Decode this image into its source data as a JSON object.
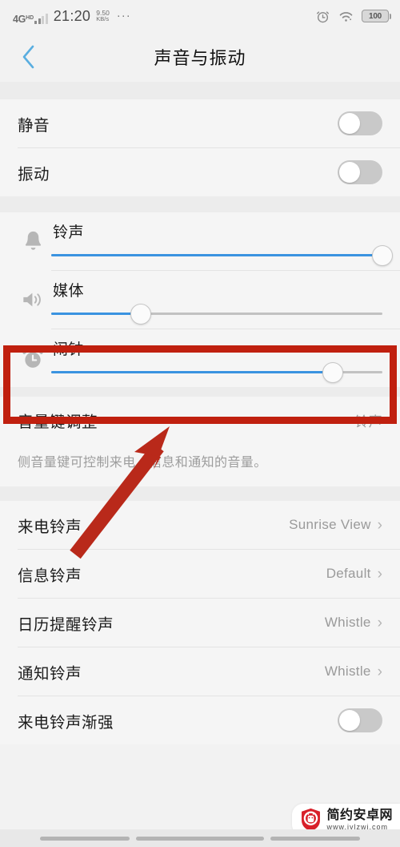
{
  "status_bar": {
    "network": "4G",
    "network_sup": "HD",
    "time": "21:20",
    "speed_value": "9.50",
    "speed_unit": "KB/s",
    "overflow": "···",
    "alarm_icon": "alarm-clock-icon",
    "wifi_icon": "wifi-icon",
    "battery_level": "100"
  },
  "header": {
    "back_icon": "back-chevron-icon",
    "title": "声音与振动"
  },
  "toggles": [
    {
      "label": "静音",
      "state": "off"
    },
    {
      "label": "振动",
      "state": "off"
    }
  ],
  "sliders": [
    {
      "label": "铃声",
      "icon": "bell-icon",
      "percent": 100
    },
    {
      "label": "媒体",
      "icon": "speaker-icon",
      "percent": 27
    },
    {
      "label": "闹钟",
      "icon": "alarm-clock-icon",
      "percent": 85
    }
  ],
  "volume_key": {
    "label": "音量键调整",
    "value": "铃声",
    "description": "侧音量键可控制来电、信息和通知的音量。"
  },
  "ringtone_rows": [
    {
      "label": "来电铃声",
      "value": "Sunrise View",
      "chevron": "›"
    },
    {
      "label": "信息铃声",
      "value": "Default",
      "chevron": "›"
    },
    {
      "label": "日历提醒铃声",
      "value": "Whistle",
      "chevron": "›"
    },
    {
      "label": "通知铃声",
      "value": "Whistle",
      "chevron": "›"
    }
  ],
  "bottom_toggle": {
    "label": "来电铃声渐强",
    "state": "off"
  },
  "annotations": {
    "highlight_box_color": "#c0200f",
    "arrow_color": "#b9291a",
    "arrow_target": "闹钟 slider"
  },
  "watermark": {
    "site_name": "简约安卓网",
    "url": "www.jylzwj.com",
    "logo_icon": "android-shield-icon"
  },
  "colors": {
    "accent_blue": "#3a93e0",
    "page_bg": "#f2f2f2",
    "card_bg": "#f5f5f5",
    "annotation_red": "#c0200f"
  }
}
